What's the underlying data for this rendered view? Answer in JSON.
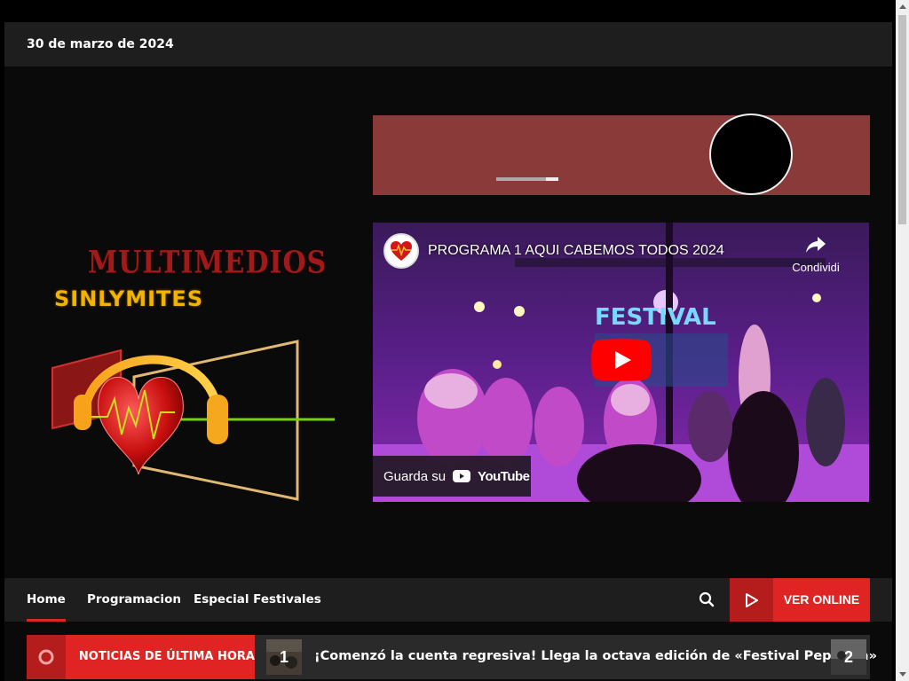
{
  "topbar": {
    "date": "30 de marzo de 2024"
  },
  "logo": {
    "line1": "MULTIMEDIOS",
    "line2": "SINLYMITES",
    "icon": "heart-headphones-logo"
  },
  "player": {
    "progress": 0.2,
    "accent": "#8b3a3a"
  },
  "video": {
    "title": "PROGRAMA 1 AQUI CABEMOS TODOS 2024",
    "share_label": "Condividi",
    "watch_label": "Guarda su",
    "youtube_label": "YouTube",
    "stage_sign": "FESTIVAL"
  },
  "nav": {
    "items": [
      {
        "label": "Home",
        "active": true
      },
      {
        "label": "Programacion",
        "active": false
      },
      {
        "label": "Especial Festivales",
        "active": false
      }
    ],
    "search_icon": "search-icon",
    "ver_online_label": "VER ONLINE",
    "accent": "#e02424"
  },
  "ticker": {
    "badge_label": "NOTICIAS DE ÚLTIMA HORA",
    "items": [
      {
        "num": "1",
        "headline": "¡Comenzó la cuenta regresiva! Llega la octava edición de «Festival Peperina»"
      },
      {
        "num": "2",
        "headline": ""
      }
    ]
  }
}
